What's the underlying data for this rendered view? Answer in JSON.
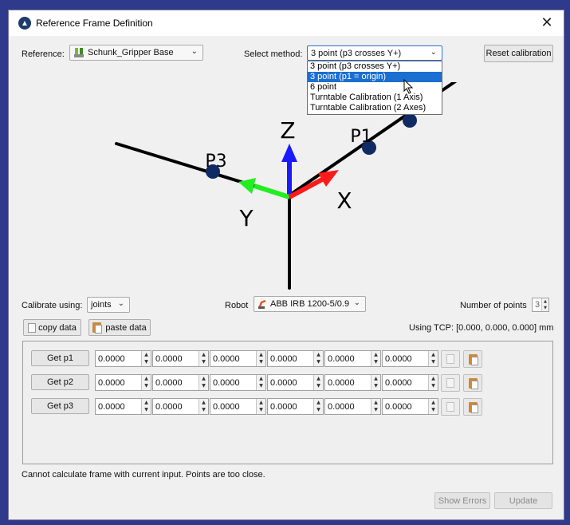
{
  "window": {
    "title": "Reference Frame Definition",
    "close_glyph": "✕"
  },
  "reference": {
    "label": "Reference:",
    "value": "Schunk_Gripper Base"
  },
  "method": {
    "label": "Select method:",
    "value": "3 point (p3 crosses Y+)",
    "options": [
      {
        "label": "3 point (p3 crosses Y+)",
        "selected": false
      },
      {
        "label": "3 point (p1 = origin)",
        "selected": true
      },
      {
        "label": "6 point",
        "selected": false
      },
      {
        "label": "Turntable Calibration (1 Axis)",
        "selected": false
      },
      {
        "label": "Turntable Calibration (2 Axes)",
        "selected": false
      }
    ]
  },
  "reset_button": "Reset calibration",
  "diagram": {
    "labels": {
      "z": "Z",
      "y": "Y",
      "x": "X",
      "p1": "P1",
      "p3": "P3"
    },
    "colors": {
      "x_axis": "#ff1a1a",
      "y_axis": "#22ee22",
      "z_axis": "#1a1aff",
      "point": "#102a63",
      "line": "#000000"
    }
  },
  "calibrate": {
    "label": "Calibrate using:",
    "value": "joints"
  },
  "robot": {
    "label": "Robot",
    "value": "ABB IRB 1200-5/0.9"
  },
  "points_count": {
    "label": "Number of points",
    "value": "3"
  },
  "copy_button": "copy data",
  "paste_button": "paste data",
  "tcp_text": "Using TCP: [0.000, 0.000, 0.000] mm",
  "rows": [
    {
      "button": "Get p1",
      "values": [
        "0.0000",
        "0.0000",
        "0.0000",
        "0.0000",
        "0.0000",
        "0.0000"
      ]
    },
    {
      "button": "Get p2",
      "values": [
        "0.0000",
        "0.0000",
        "0.0000",
        "0.0000",
        "0.0000",
        "0.0000"
      ]
    },
    {
      "button": "Get p3",
      "values": [
        "0.0000",
        "0.0000",
        "0.0000",
        "0.0000",
        "0.0000",
        "0.0000"
      ]
    }
  ],
  "status_message": "Cannot calculate frame with current input. Points are too close.",
  "footer": {
    "show_errors": "Show Errors",
    "update": "Update"
  }
}
